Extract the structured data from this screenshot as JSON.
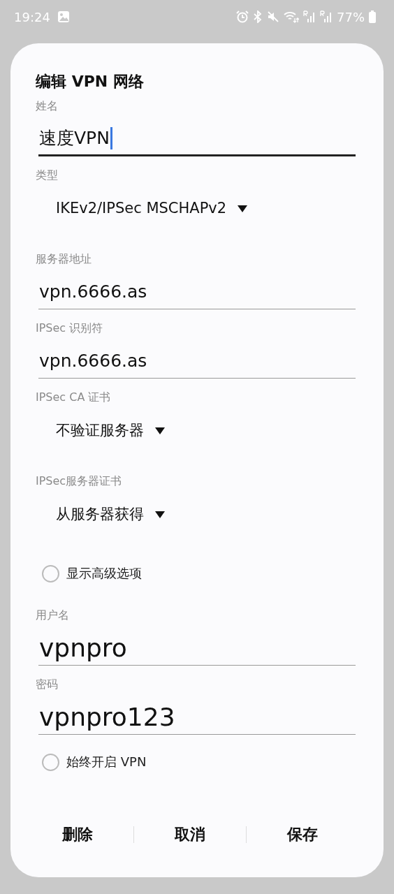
{
  "status_bar": {
    "time": "19:24",
    "battery": "77%"
  },
  "dialog": {
    "title": "编辑 VPN 网络",
    "fields": [
      {
        "kind": "text",
        "label": "姓名",
        "value": "速度VPN",
        "focused": true
      },
      {
        "kind": "dropdown",
        "label": "类型",
        "value": "IKEv2/IPSec MSCHAPv2"
      },
      {
        "kind": "text",
        "label": "服务器地址",
        "value": "vpn.6666.as",
        "focused": false
      },
      {
        "kind": "text",
        "label": "IPSec 识别符",
        "value": "vpn.6666.as",
        "focused": false
      },
      {
        "kind": "dropdown",
        "label": "IPSec CA 证书",
        "value": "不验证服务器"
      },
      {
        "kind": "dropdown",
        "label": "IPSec服务器证书",
        "value": "从服务器获得"
      },
      {
        "kind": "checkbox",
        "label": "显示高级选项",
        "checked": false
      },
      {
        "kind": "credential",
        "label": "用户名",
        "value": "vpnpro",
        "focused": false
      },
      {
        "kind": "credential",
        "label": "密码",
        "value": "vpnpro123",
        "focused": false
      },
      {
        "kind": "checkbox",
        "label": "始终开启 VPN",
        "checked": false
      }
    ],
    "buttons": [
      "删除",
      "取消",
      "保存"
    ]
  }
}
